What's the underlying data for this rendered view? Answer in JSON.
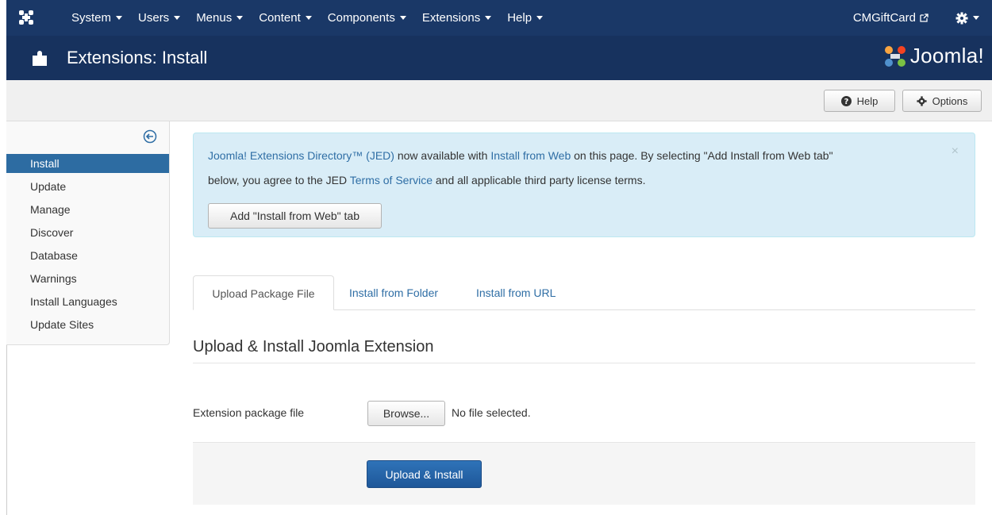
{
  "navbar": {
    "menu": [
      {
        "label": "System"
      },
      {
        "label": "Users"
      },
      {
        "label": "Menus"
      },
      {
        "label": "Content"
      },
      {
        "label": "Components"
      },
      {
        "label": "Extensions"
      },
      {
        "label": "Help"
      }
    ],
    "site_name": "CMGiftCard",
    "gear_icon": "gear-icon",
    "logo_icon": "joomla-mark-icon"
  },
  "header": {
    "title": "Extensions: Install",
    "icon": "puzzle-icon",
    "brand": "Joomla!"
  },
  "toolbar": {
    "help_label": "Help",
    "options_label": "Options"
  },
  "sidebar": {
    "items": [
      {
        "label": "Install",
        "active": true
      },
      {
        "label": "Update"
      },
      {
        "label": "Manage"
      },
      {
        "label": "Discover"
      },
      {
        "label": "Database"
      },
      {
        "label": "Warnings"
      },
      {
        "label": "Install Languages"
      },
      {
        "label": "Update Sites"
      }
    ]
  },
  "alert": {
    "jed_link": "Joomla! Extensions Directory™ (JED)",
    "text1a": " now available with ",
    "install_web_link": "Install from Web",
    "text1b": " on this page.  By selecting \"Add Install from Web tab\"",
    "text2a": "below, you agree to the JED ",
    "tos_link": "Terms of Service",
    "text2b": " and all applicable third party license terms.",
    "button_label": "Add \"Install from Web\" tab",
    "close": "×"
  },
  "tabs": [
    {
      "label": "Upload Package File",
      "active": true
    },
    {
      "label": "Install from Folder"
    },
    {
      "label": "Install from URL"
    }
  ],
  "form": {
    "heading": "Upload & Install Joomla Extension",
    "field_label": "Extension package file",
    "browse_label": "Browse...",
    "file_status": "No file selected.",
    "submit_label": "Upload & Install"
  },
  "colors": {
    "navbar": "#1a3867",
    "header": "#17325e",
    "active_item": "#2d6ca2",
    "alert_bg": "#d9edf7",
    "link": "#2f6ea5",
    "primary_button": "#1e5799"
  }
}
